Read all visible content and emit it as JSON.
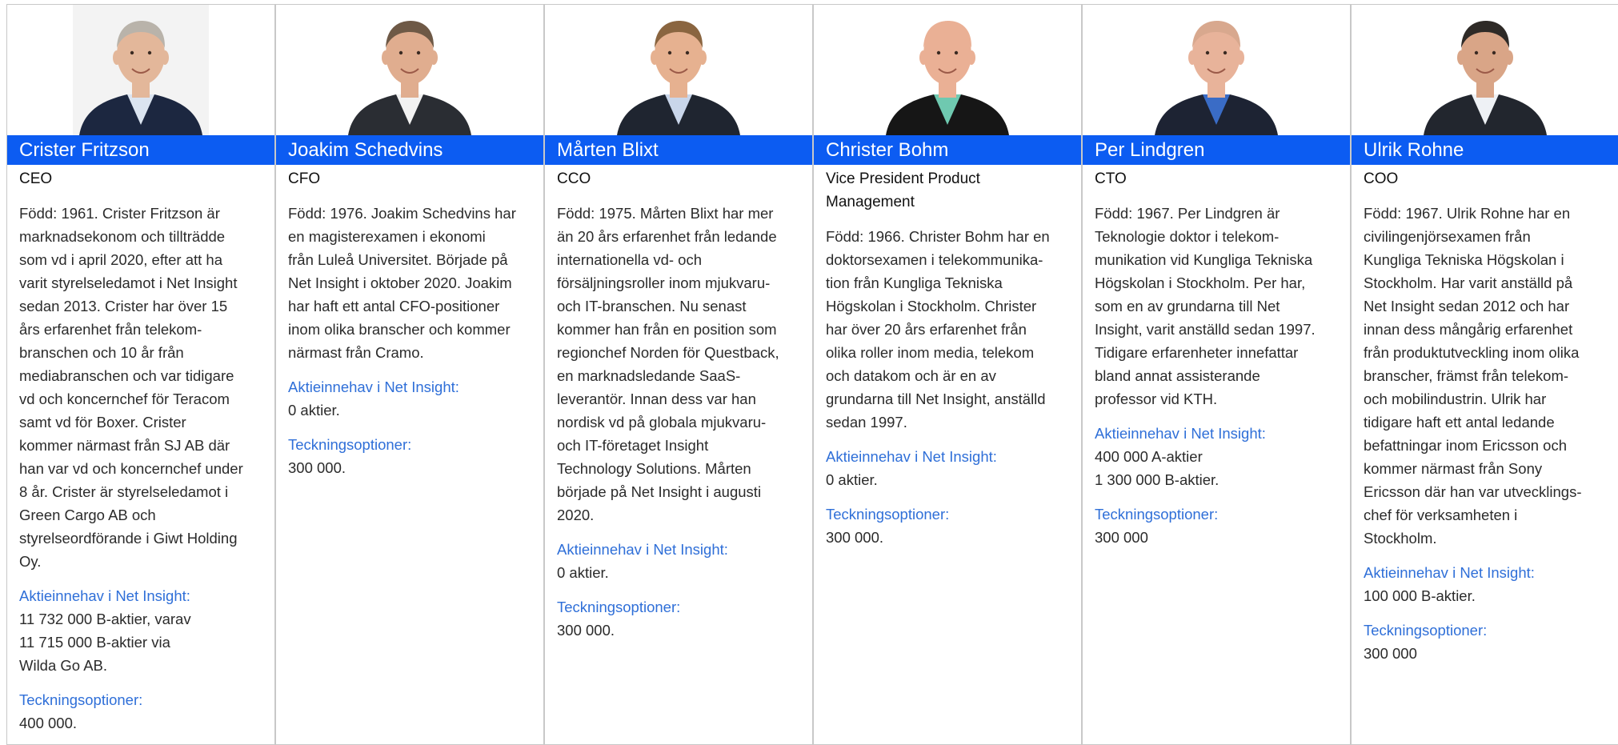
{
  "people": [
    {
      "name": "Crister Fritzson",
      "role": "CEO",
      "bio": "Född: 1961. Crister Fritzson är\nmarknadsekonom och tillträdde\nsom vd i april 2020, efter att ha\nvarit styrelseledamot i Net Insight\nsedan 2013. Crister har över 15\nårs erfarenhet från telekom-\nbranschen och 10 år från\nmediabranschen och var tidigare\nvd och koncernchef för Teracom\nsamt vd för Boxer. Crister\nkommer närmast från SJ AB där\nhan var vd och koncernchef under\n8 år. Crister är styrelseledamot i\nGreen Cargo AB och\nstyrelseordförande i Giwt Holding\nOy.",
      "holdings_label": "Aktieinnehav i Net Insight:",
      "holdings_value": "11 732 000 B-aktier, varav\n11 715 000 B-aktier via\nWilda Go AB.",
      "options_label": "Teckningsoptioner:",
      "options_value": "400 000.",
      "portrait": {
        "bg": "#f3f3f3",
        "suit": "#1c2740",
        "shirt": "#dbe4f0",
        "skin": "#e3b79a",
        "hair": "#b9b3aa"
      }
    },
    {
      "name": "Joakim Schedvins",
      "role": "CFO",
      "bio": "Född: 1976. Joakim Schedvins har\nen magisterexamen i ekonomi\nfrån Luleå Universitet. Började på\nNet Insight i oktober 2020. Joakim\nhar haft ett antal CFO-positioner\ninom olika branscher och kommer\nnärmast från Cramo.",
      "holdings_label": "Aktieinnehav i Net Insight:",
      "holdings_value": "0 aktier.",
      "options_label": "Teckningsoptioner:",
      "options_value": "300 000.",
      "portrait": {
        "bg": "#ffffff",
        "suit": "#2a2d33",
        "shirt": "#f2f2f2",
        "skin": "#e0ad8f",
        "hair": "#6e5946"
      }
    },
    {
      "name": "Mårten Blixt",
      "role": "CCO",
      "bio": "Född: 1975. Mårten Blixt har mer\nän 20 års erfarenhet från ledande\ninternationella vd- och\nförsäljningsroller inom mjukvaru-\noch IT-branschen. Nu senast\nkommer han från en position som\nregionchef Norden för Questback,\nen marknadsledande SaaS-\nleverantör. Innan dess var han\nnordisk vd på globala mjukvaru-\noch IT-företaget Insight\nTechnology Solutions. Mårten\nbörjade på Net Insight i augusti\n2020.",
      "holdings_label": "Aktieinnehav i Net Insight:",
      "holdings_value": "0 aktier.",
      "options_label": "Teckningsoptioner:",
      "options_value": "300 000.",
      "portrait": {
        "bg": "#ffffff",
        "suit": "#1f2530",
        "shirt": "#c9d6ea",
        "skin": "#e6b190",
        "hair": "#8a6540"
      }
    },
    {
      "name": "Christer Bohm",
      "role": "Vice President Product Management",
      "bio": "Född: 1966. Christer Bohm har en\ndoktorsexamen i telekommunika-\ntion från Kungliga Tekniska\nHögskolan i Stockholm. Christer\nhar över 20 års erfarenhet från\nolika roller inom media, telekom\noch datakom och är en av\ngrundarna till Net Insight, anställd\nsedan 1997.",
      "holdings_label": "Aktieinnehav i Net Insight:",
      "holdings_value": "0 aktier.",
      "options_label": "Teckningsoptioner:",
      "options_value": "300 000.",
      "portrait": {
        "bg": "#ffffff",
        "suit": "#161616",
        "shirt": "#6fc9b0",
        "skin": "#eab095",
        "hair": "#eab095"
      }
    },
    {
      "name": "Per Lindgren",
      "role": "CTO",
      "bio": "Född: 1967. Per Lindgren är\nTeknologie doktor i telekom-\nmunikation vid Kungliga Tekniska\nHögskolan i Stockholm. Per har,\nsom en av grundarna till Net\nInsight, varit anställd sedan 1997.\nTidigare erfarenheter innefattar\nbland annat assisterande\nprofessor vid KTH.",
      "holdings_label": "Aktieinnehav i Net Insight:",
      "holdings_value": "400 000 A-aktier\n1 300 000 B-aktier.",
      "options_label": "Teckningsoptioner:",
      "options_value": "300 000",
      "portrait": {
        "bg": "#ffffff",
        "suit": "#1d2333",
        "shirt": "#3a6cc6",
        "skin": "#e8b39a",
        "hair": "#d8a88e"
      }
    },
    {
      "name": "Ulrik Rohne",
      "role": "COO",
      "bio": "Född: 1967. Ulrik Rohne har en\ncivilingenjörsexamen från\nKungliga Tekniska Högskolan i\nStockholm. Har varit anställd på\nNet Insight sedan 2012 och har\ninnan dess mångårig erfarenhet\nfrån produktutveckling inom olika\nbranscher, främst från telekom-\noch mobilindustrin. Ulrik har\ntidigare haft ett antal ledande\nbefattningar inom Ericsson och\nkommer närmast från Sony\nEricsson där han var utvecklings-\nchef för verksamheten i\nStockholm.",
      "holdings_label": "Aktieinnehav i Net Insight:",
      "holdings_value": "100 000 B-aktier.",
      "options_label": "Teckningsoptioner:",
      "options_value": "300 000",
      "portrait": {
        "bg": "#ffffff",
        "suit": "#22262e",
        "shirt": "#eef1f5",
        "skin": "#d9a587",
        "hair": "#2e2a27"
      }
    }
  ]
}
